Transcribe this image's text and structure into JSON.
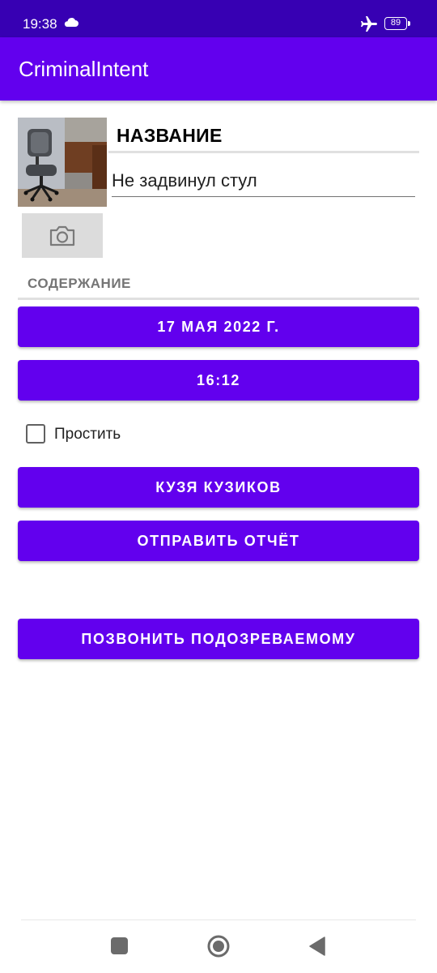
{
  "status_bar": {
    "time": "19:38",
    "battery_level": "89",
    "icons": [
      "cloud-icon",
      "airplane-mode-icon",
      "battery-icon"
    ],
    "color": "#3700b3"
  },
  "app_bar": {
    "title": "CriminalIntent",
    "color": "#6200ee"
  },
  "crime": {
    "photo_icon": "camera-icon",
    "title_label": "НАЗВАНИЕ",
    "title_value": "Не задвинул стул",
    "details_label": "СОДЕРЖАНИЕ",
    "date_button": "17 МАЯ 2022 Г.",
    "time_button": "16:12",
    "solved_label": "Простить",
    "solved_checked": false,
    "suspect_button": "КУЗЯ КУЗИКОВ",
    "report_button": "ОТПРАВИТЬ ОТЧЁТ",
    "call_button": "ПОЗВОНИТЬ ПОДОЗРЕВАЕМОМУ"
  },
  "nav_bar": {
    "icons": [
      "recents-icon",
      "home-icon",
      "back-icon"
    ]
  }
}
